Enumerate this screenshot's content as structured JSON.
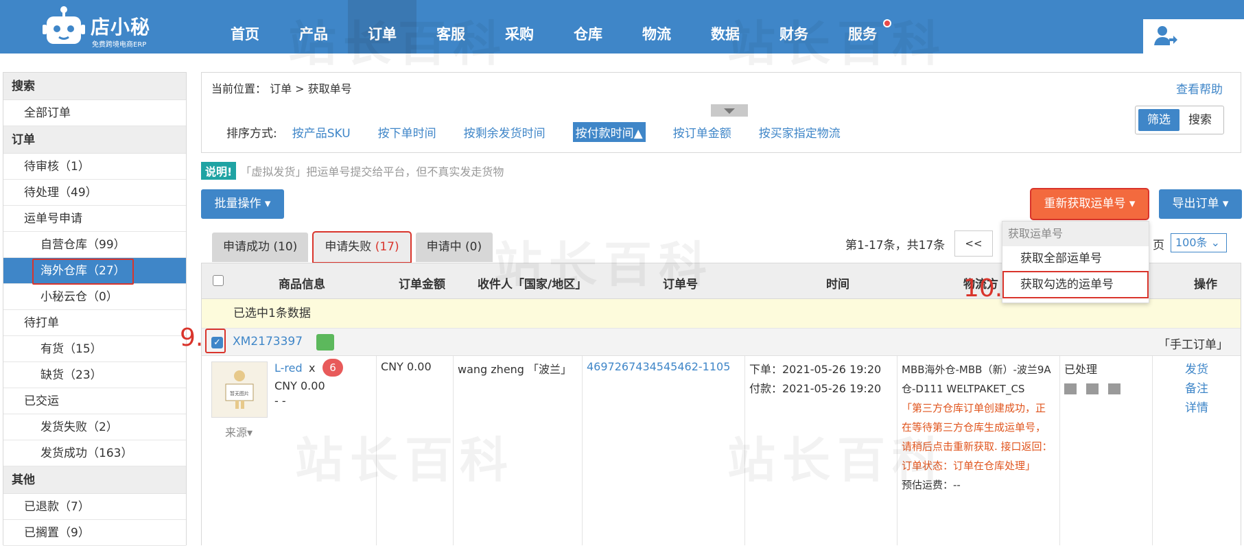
{
  "app": {
    "logo_name": "店小秘",
    "logo_sub": "免费跨境电商ERP"
  },
  "nav": [
    "首页",
    "产品",
    "订单",
    "客服",
    "采购",
    "仓库",
    "物流",
    "数据",
    "财务",
    "服务"
  ],
  "sidebar": {
    "search_head": "搜索",
    "all_orders": "全部订单",
    "order_head": "订单",
    "items": [
      {
        "label": "待审核",
        "count": "（1）"
      },
      {
        "label": "待处理",
        "count": "（49）"
      },
      {
        "label": "运单号申请",
        "count": ""
      },
      {
        "label": "自营仓库",
        "count": "（99）"
      },
      {
        "label": "海外仓库",
        "count": "（27）"
      },
      {
        "label": "小秘云仓",
        "count": "（0）"
      },
      {
        "label": "待打单",
        "count": ""
      },
      {
        "label": "有货",
        "count": "（15）"
      },
      {
        "label": "缺货",
        "count": "（23）"
      },
      {
        "label": "已交运",
        "count": ""
      },
      {
        "label": "发货失败",
        "count": "（2）"
      },
      {
        "label": "发货成功",
        "count": "（163）"
      }
    ],
    "other_head": "其他",
    "other_items": [
      {
        "label": "已退款",
        "count": "（7）"
      },
      {
        "label": "已搁置",
        "count": "（9）"
      }
    ]
  },
  "breadcrumb": "当前位置： 订单 > 获取单号",
  "help": "查看帮助",
  "sort": {
    "label": "排序方式:",
    "options": [
      "按产品SKU",
      "按下单时间",
      "按剩余发货时间",
      "按付款时间▲",
      "按订单金额",
      "按买家指定物流"
    ]
  },
  "segment": [
    "筛选",
    "搜索"
  ],
  "notice": {
    "tag": "说明!",
    "text": "「虚拟发货」把运单号提交给平台，但不真实发走货物"
  },
  "buttons": {
    "batch": "批量操作 ▾",
    "regain": "重新获取运单号 ▾",
    "export": "导出订单 ▾"
  },
  "tabs": [
    {
      "label": "申请成功",
      "count": "(10)"
    },
    {
      "label": "申请失败",
      "count": "(17)"
    },
    {
      "label": "申请中",
      "count": "(0)"
    }
  ],
  "pager": {
    "info": "第1-17条，共17条",
    "first": "<<",
    "perpage_label": "页",
    "perpage": "100条 ⌄"
  },
  "dropdown": {
    "head": "获取运单号",
    "items": [
      "获取全部运单号",
      "获取勾选的运单号"
    ]
  },
  "annotations": {
    "step9": "9.",
    "step10": "10."
  },
  "table": {
    "headers": [
      "商品信息",
      "订单金额",
      "收件人「国家/地区」",
      "订单号",
      "时间",
      "物流方",
      "操作"
    ],
    "selected_text": "已选中1条数据",
    "order_no": "XM2173397",
    "manual": "「手工订单」",
    "sku": "L-red",
    "x": "x",
    "qty": "6",
    "item_price": "CNY 0.00",
    "dashes": "- -",
    "source": "来源▾",
    "amount": "CNY 0.00",
    "receiver": "wang zheng 「波兰」",
    "order_id": "4697267434545462-1105",
    "time_order": "下单：2021-05-26 19:20",
    "time_pay": "付款：2021-05-26 19:20",
    "logistics": "MBB海外仓-MBB（新）-波兰9A仓-D111 WELTPAKET_CS",
    "logistics_msg": "「第三方仓库订单创建成功，正在等待第三方仓库生成运单号，请稍后点击重新获取. 接口返回：订单状态：订单在仓库处理」",
    "freight": "预估运费：--",
    "status": "已处理",
    "actions": [
      "发货",
      "备注",
      "详情"
    ]
  },
  "thumb_text": "暂无图片",
  "watermark": "站长百科"
}
